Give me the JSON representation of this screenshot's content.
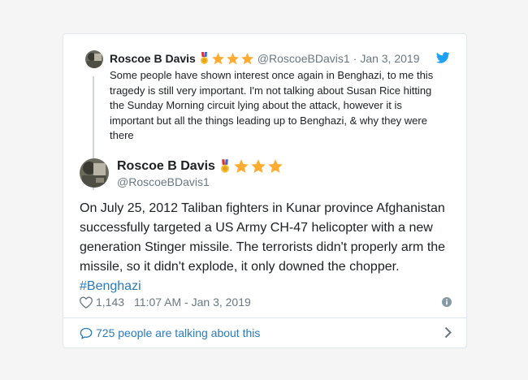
{
  "parent_tweet": {
    "author_name": "Roscoe B Davis",
    "handle": "@RoscoeBDavis1",
    "separator": "·",
    "date": "Jan 3, 2019",
    "text": "Some people have shown interest once again in Benghazi, to me this tragedy is still very important. I'm not talking about Susan Rice hitting the Sunday Morning circuit lying about the attack, however it is important but all the things leading up to Benghazi, & why they were there"
  },
  "main_tweet": {
    "author_name": "Roscoe B Davis",
    "handle": "@RoscoeBDavis1",
    "text": "On July 25, 2012 Taliban fighters in Kunar province Afghanistan successfully targeted a US Army CH-47 helicopter with a new generation Stinger missile. The terrorists didn't properly arm the missile, so it didn't explode, it only downed the chopper.",
    "hashtag": "#Benghazi",
    "likes": "1,143",
    "timestamp": "11:07 AM - Jan 3, 2019"
  },
  "footer": {
    "talking_text": "725 people are talking about this"
  },
  "icons": {
    "brand": "twitter-bird-icon",
    "like": "heart-icon",
    "info": "info-icon",
    "conversation": "speech-bubble-icon",
    "chevron": "chevron-right-icon",
    "badges": [
      "medal-icon",
      "star-icon",
      "star-icon",
      "star-icon"
    ]
  },
  "colors": {
    "twitter_blue": "#1da1f2",
    "link_blue": "#2b7bb9",
    "star_gold": "#ffac33",
    "secondary_text": "#697882"
  }
}
